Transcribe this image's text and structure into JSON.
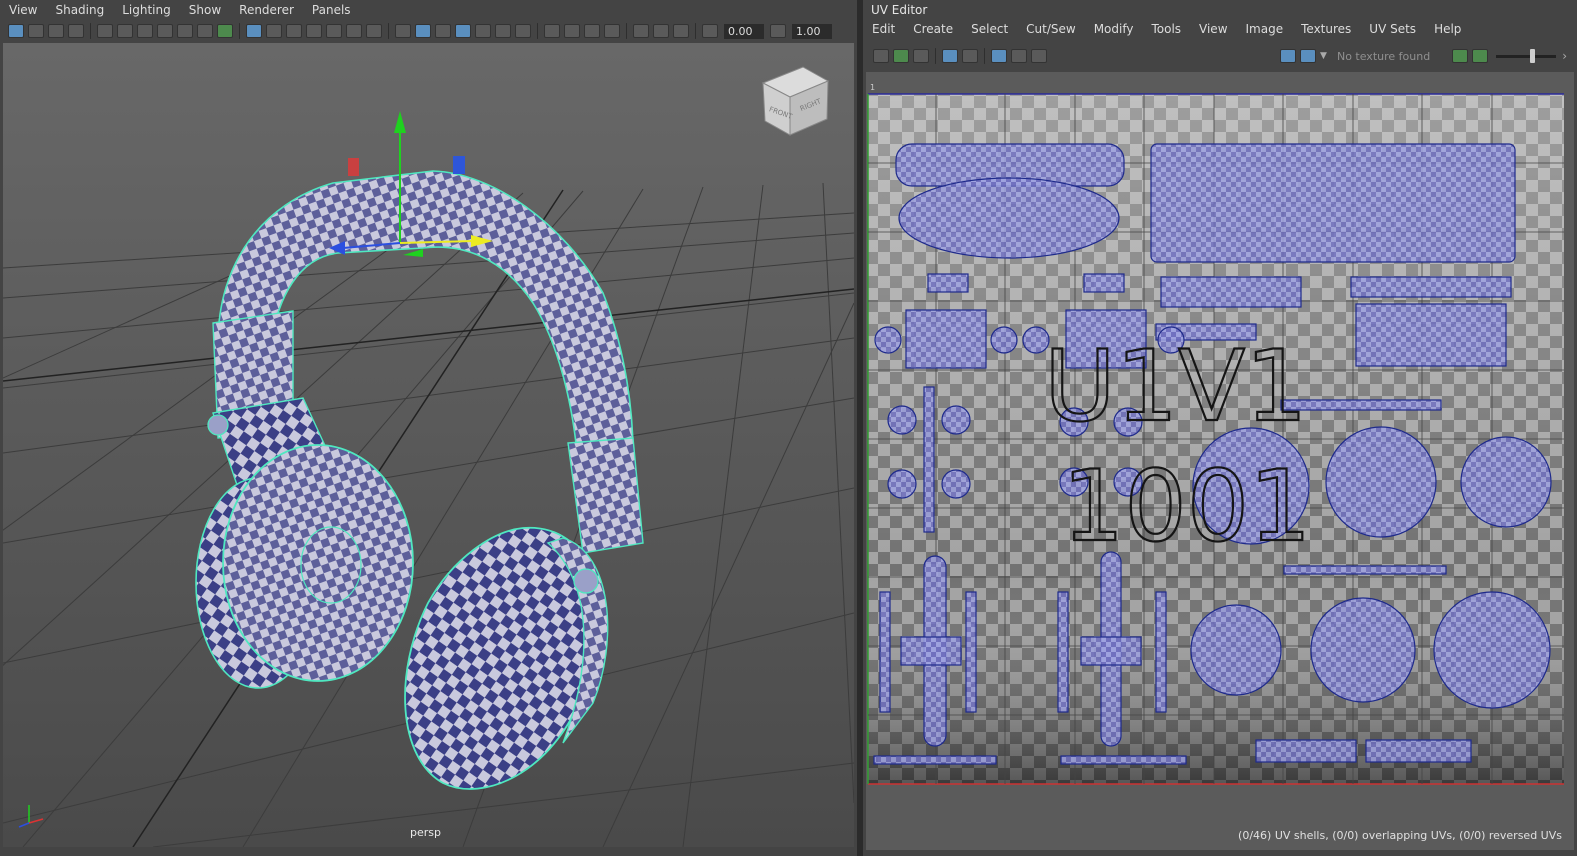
{
  "viewport_panel": {
    "menu": [
      "View",
      "Shading",
      "Lighting",
      "Show",
      "Renderer",
      "Panels"
    ],
    "toolbar_fields": {
      "gamma": "0.00",
      "exposure": "1.00"
    },
    "camera_label": "persp",
    "viewcube_faces": [
      "FRONT",
      "RIGHT"
    ],
    "icons": [
      "select-camera-icon",
      "camera-attributes-icon",
      "bookmark-icon",
      "image-plane-icon",
      "grease-pencil-icon",
      "grid-icon",
      "film-gate-icon",
      "resolution-gate-icon",
      "gate-mask-icon",
      "field-chart-icon",
      "safe-action-icon",
      "wireframe-icon",
      "smooth-shade-icon",
      "default-lighting-icon",
      "textured-icon",
      "shadows-icon",
      "isolate-select-icon",
      "xray-icon",
      "exposure-icon",
      "gamma-icon"
    ]
  },
  "uv_editor": {
    "title": "UV Editor",
    "menu": [
      "Edit",
      "Create",
      "Select",
      "Cut/Sew",
      "Modify",
      "Tools",
      "View",
      "Image",
      "Textures",
      "UV Sets",
      "Help"
    ],
    "texture_status": "No texture found",
    "tile_label_top": "U1V1",
    "tile_label_bottom": "1001",
    "tile_corner_label": "1",
    "status_line": "(0/46) UV shells, (0/0) overlapping UVs, (0/0) reversed UVs",
    "icons": [
      "uv-shell-select-icon",
      "uv-toolkit-icon",
      "display-image-icon",
      "checker-icon",
      "shaded-uvs-icon",
      "grid-display-icon",
      "snapshot-icon",
      "exposure-icon"
    ]
  },
  "colors": {
    "accent_wire": "#4fe8c0",
    "uv_shell_fill": "#5a62c8",
    "manip_y": "#1fd11f",
    "manip_x": "#d33",
    "manip_z": "#2b4fe0"
  }
}
